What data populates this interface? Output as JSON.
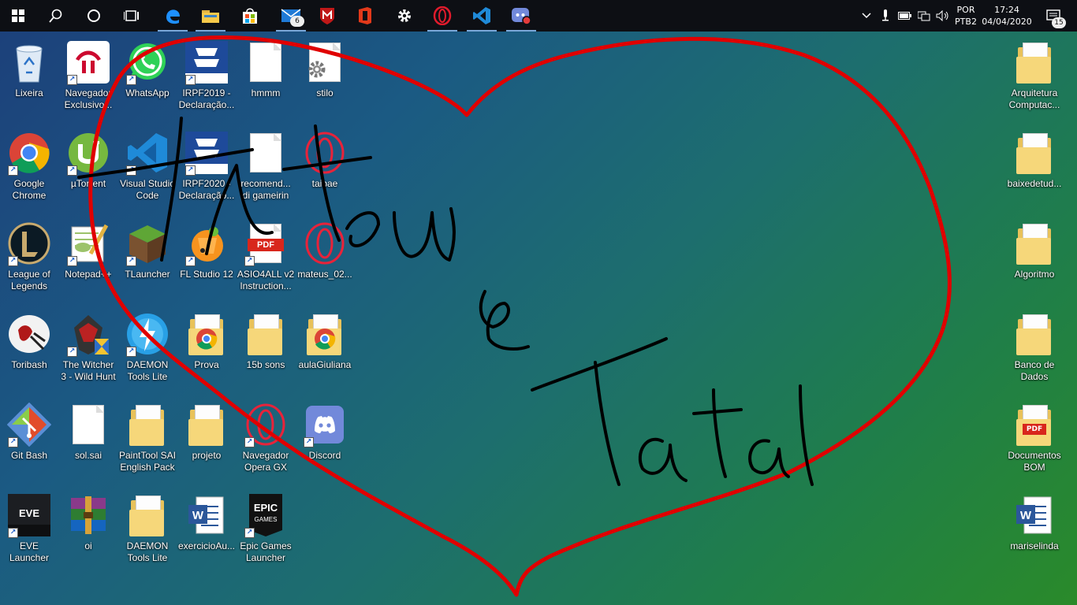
{
  "taskbar": {
    "buttons": [
      {
        "name": "start",
        "icon": "windows-logo-icon"
      },
      {
        "name": "search",
        "icon": "search-icon"
      },
      {
        "name": "cortana",
        "icon": "circle-icon"
      },
      {
        "name": "task-view",
        "icon": "task-view-icon"
      },
      {
        "name": "edge",
        "icon": "edge-icon"
      },
      {
        "name": "file-explorer",
        "icon": "folder-icon"
      },
      {
        "name": "store",
        "icon": "store-icon"
      },
      {
        "name": "mail",
        "icon": "mail-icon",
        "badge": "6"
      },
      {
        "name": "mcafee",
        "icon": "mcafee-icon"
      },
      {
        "name": "office",
        "icon": "office-icon"
      },
      {
        "name": "settings",
        "icon": "gear-icon"
      },
      {
        "name": "opera",
        "icon": "opera-icon"
      },
      {
        "name": "vscode",
        "icon": "vscode-icon"
      },
      {
        "name": "discord",
        "icon": "discord-icon"
      }
    ],
    "tray": {
      "language": "POR",
      "layout": "PTB2",
      "time": "17:24",
      "date": "04/04/2020",
      "notifications": "15"
    }
  },
  "desktop": {
    "icons": [
      {
        "label": "Lixeira",
        "type": "recycle",
        "shortcut": false
      },
      {
        "label": "Navegador Exclusivo...",
        "type": "bradesco",
        "shortcut": true
      },
      {
        "label": "WhatsApp",
        "type": "whatsapp",
        "shortcut": true
      },
      {
        "label": "IRPF2019 - Declaração...",
        "type": "irpf",
        "shortcut": true
      },
      {
        "label": "hmmm",
        "type": "doc",
        "shortcut": false
      },
      {
        "label": "stilo",
        "type": "settings-doc",
        "shortcut": false
      },
      {
        "label": "Google Chrome",
        "type": "chrome",
        "shortcut": true
      },
      {
        "label": "µTorrent",
        "type": "utorrent",
        "shortcut": true
      },
      {
        "label": "Visual Studio Code",
        "type": "vscode",
        "shortcut": true
      },
      {
        "label": "IRPF2020 - Declaração...",
        "type": "irpf",
        "shortcut": true
      },
      {
        "label": "recomend... di gameirin",
        "type": "doc",
        "shortcut": false
      },
      {
        "label": "taibae",
        "type": "opera",
        "shortcut": false
      },
      {
        "label": "League of Legends",
        "type": "lol",
        "shortcut": true
      },
      {
        "label": "Notepad++",
        "type": "notepadpp",
        "shortcut": true
      },
      {
        "label": "TLauncher",
        "type": "minecraft",
        "shortcut": true
      },
      {
        "label": "FL Studio 12",
        "type": "flstudio",
        "shortcut": true
      },
      {
        "label": "ASIO4ALL v2 Instruction...",
        "type": "pdf",
        "shortcut": true
      },
      {
        "label": "mateus_02...",
        "type": "opera",
        "shortcut": false
      },
      {
        "label": "Toribash",
        "type": "toribash",
        "shortcut": false
      },
      {
        "label": "The Witcher 3 - Wild Hunt",
        "type": "witcher",
        "shortcut": true
      },
      {
        "label": "DAEMON Tools Lite",
        "type": "daemon",
        "shortcut": true
      },
      {
        "label": "Prova",
        "type": "chrome-folder",
        "shortcut": false
      },
      {
        "label": "15b sons",
        "type": "folder",
        "shortcut": false
      },
      {
        "label": "aulaGiuliana",
        "type": "chrome-folder",
        "shortcut": false
      },
      {
        "label": "Git Bash",
        "type": "git",
        "shortcut": true
      },
      {
        "label": "sol.sai",
        "type": "blank",
        "shortcut": false
      },
      {
        "label": "PaintTool SAI English Pack",
        "type": "folder",
        "shortcut": false
      },
      {
        "label": "projeto",
        "type": "folder",
        "shortcut": false
      },
      {
        "label": "Navegador Opera GX",
        "type": "opera",
        "shortcut": true
      },
      {
        "label": "Discord",
        "type": "discord",
        "shortcut": true
      },
      {
        "label": "EVE Launcher",
        "type": "eve",
        "shortcut": true
      },
      {
        "label": "oi",
        "type": "winrar",
        "shortcut": false
      },
      {
        "label": "DAEMON Tools Lite",
        "type": "folder",
        "shortcut": false
      },
      {
        "label": "exercicioAu...",
        "type": "word",
        "shortcut": false
      },
      {
        "label": "Epic Games Launcher",
        "type": "epic",
        "shortcut": true
      }
    ],
    "right_icons": [
      {
        "label": "Arquitetura Computac...",
        "type": "folder"
      },
      {
        "label": "baixedetud...",
        "type": "folder"
      },
      {
        "label": "Algoritmo",
        "type": "folder"
      },
      {
        "label": "Banco de Dados",
        "type": "folder"
      },
      {
        "label": "Documentos BOM",
        "type": "pdf-folder"
      },
      {
        "label": "mariselinda",
        "type": "word"
      }
    ]
  },
  "colors": {
    "heart_stroke": "#e00000",
    "ink": "#000000",
    "accent": "#7aa7d8"
  }
}
